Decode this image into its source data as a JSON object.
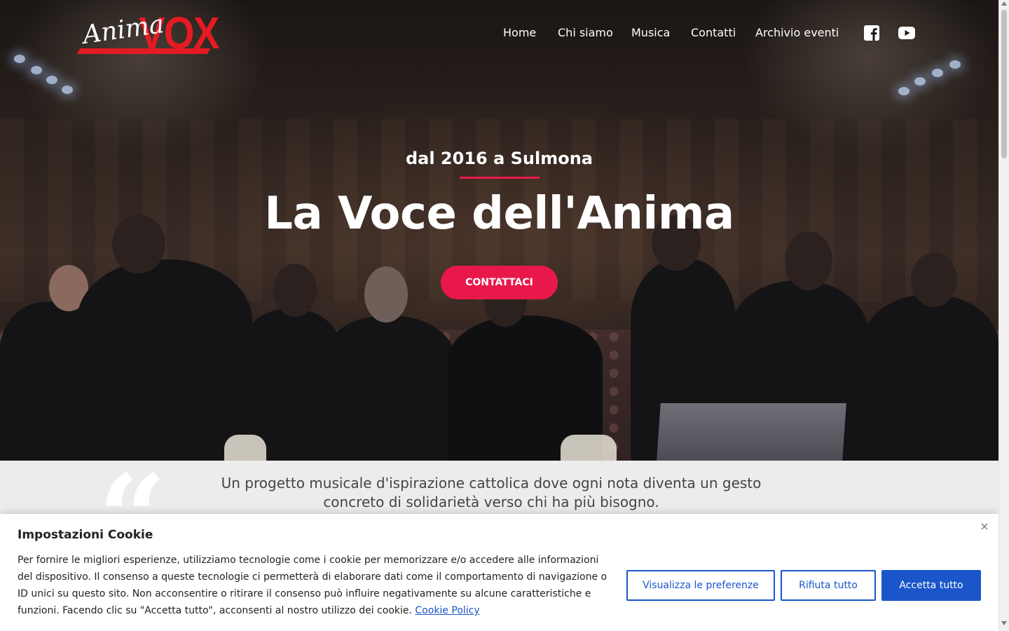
{
  "brand": {
    "logo_script": "Anima",
    "logo_bold": "VOX",
    "accent_color": "#e41b23"
  },
  "nav": {
    "items": [
      {
        "label": "Home"
      },
      {
        "label": "Chi siamo"
      },
      {
        "label": "Musica"
      },
      {
        "label": "Contatti"
      },
      {
        "label": "Archivio eventi"
      }
    ],
    "social": [
      {
        "icon": "facebook-icon"
      },
      {
        "icon": "youtube-icon"
      }
    ]
  },
  "hero": {
    "tagline": "dal 2016 a Sulmona",
    "headline": "La Voce dell'Anima",
    "cta_label": "CONTATTACI",
    "cta_color": "#e8194a"
  },
  "quote": {
    "mark": "“",
    "text": "Un progetto musicale d'ispirazione cattolica dove ogni nota diventa un gesto concreto di solidarietà verso chi ha più bisogno."
  },
  "cookie": {
    "title": "Impostazioni Cookie",
    "close_symbol": "×",
    "body": "Per fornire le migliori esperienze, utilizziamo tecnologie come i cookie per memorizzare e/o accedere alle informazioni del dispositivo. Il consenso a queste tecnologie ci permetterà di elaborare dati come il comportamento di navigazione o ID unici su questo sito. Non acconsentire o ritirare il consenso può influire negativamente su alcune caratteristiche e funzioni.  Facendo clic su \"Accetta tutto\", acconsenti al nostro utilizzo dei cookie.",
    "policy_link": "Cookie Policy",
    "buttons": {
      "preferences": "Visualizza le preferenze",
      "reject": "Rifiuta tutto",
      "accept": "Accetta tutto"
    },
    "button_color": "#1a56c9"
  }
}
